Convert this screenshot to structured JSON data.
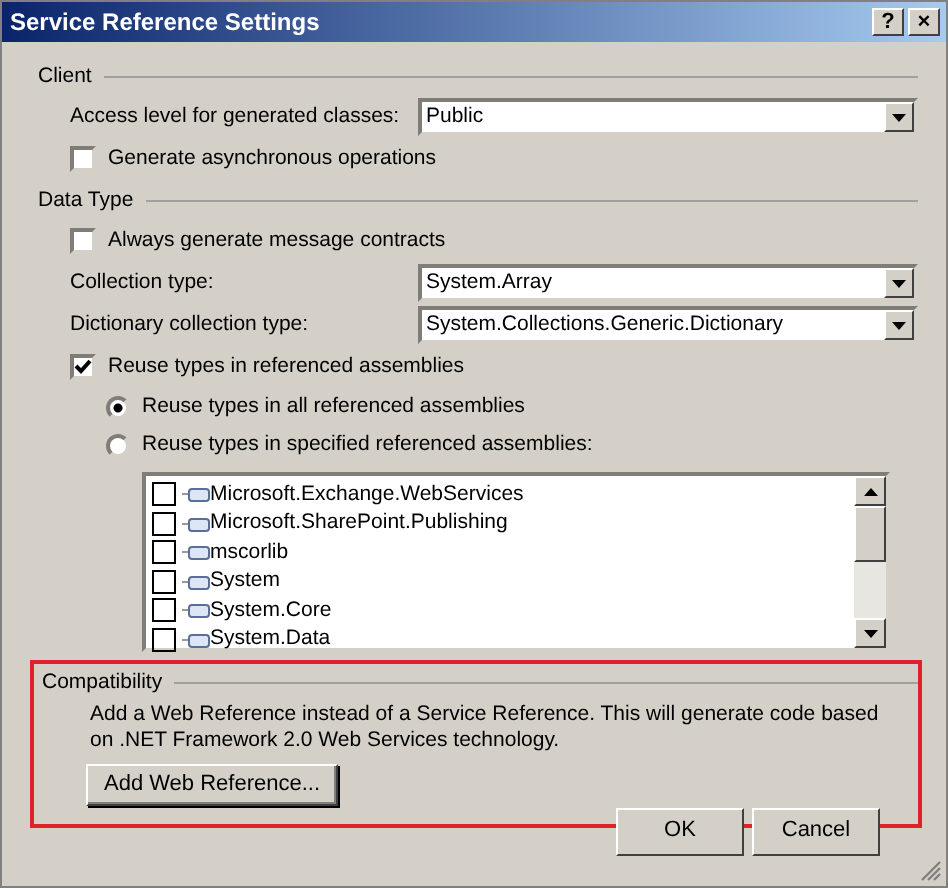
{
  "window": {
    "title": "Service Reference Settings",
    "title_buttons": [
      "?",
      "×"
    ]
  },
  "client": {
    "label": "Client",
    "access_level": {
      "label": "Access level for generated classes:",
      "value": "Public"
    },
    "async": {
      "label": "Generate asynchronous operations",
      "checked": false
    }
  },
  "data_type": {
    "label": "Data Type",
    "message_contracts": {
      "label": "Always generate message contracts",
      "checked": false
    },
    "collection": {
      "label": "Collection type:",
      "value": "System.Array"
    },
    "dictionary": {
      "label": "Dictionary collection type:",
      "value": "System.Collections.Generic.Dictionary"
    },
    "reuse": {
      "label": "Reuse types in referenced assemblies",
      "checked": true
    },
    "reuse_options": [
      {
        "label": "Reuse types in all referenced assemblies",
        "selected": true
      },
      {
        "label": "Reuse types in specified referenced assemblies:",
        "selected": false
      }
    ],
    "assemblies": [
      {
        "name": "Microsoft.Exchange.WebServices",
        "checked": false
      },
      {
        "name": "Microsoft.SharePoint.Publishing",
        "checked": false
      },
      {
        "name": "mscorlib",
        "checked": false
      },
      {
        "name": "System",
        "checked": false
      },
      {
        "name": "System.Core",
        "checked": false
      },
      {
        "name": "System.Data",
        "checked": false
      }
    ]
  },
  "compatibility": {
    "label": "Compatibility",
    "description": "Add a Web Reference instead of a Service Reference. This will generate code based on .NET Framework 2.0 Web Services technology.",
    "button": "Add Web Reference..."
  },
  "buttons": [
    "OK",
    "Cancel"
  ]
}
